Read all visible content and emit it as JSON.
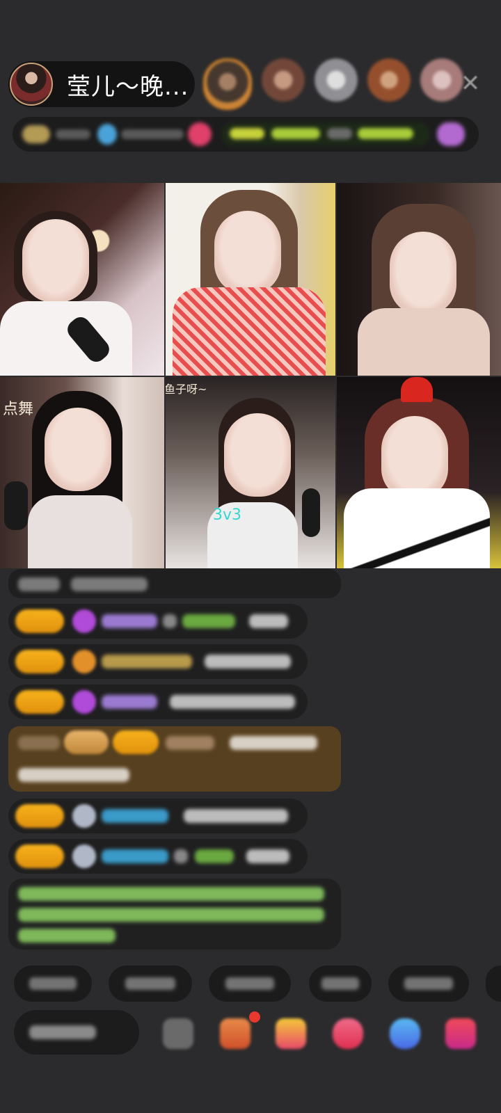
{
  "header": {
    "host_name": "莹儿～晚...",
    "close_icon": "close-icon"
  },
  "video_grid": {
    "tiles": [
      {
        "overlay_text": ""
      },
      {
        "overlay_text": ""
      },
      {
        "overlay_text": ""
      },
      {
        "overlay_text": "点舞"
      },
      {
        "overlay_text": "鱼子呀~",
        "center_label": "3v3"
      },
      {
        "overlay_text": ""
      }
    ]
  },
  "colors": {
    "background": "#2b2b2d",
    "badge_gold": "#f7b21c",
    "system_text_green": "#8fd16b",
    "gift_bg": "#57401f",
    "label_cyan": "#36d6d0"
  }
}
